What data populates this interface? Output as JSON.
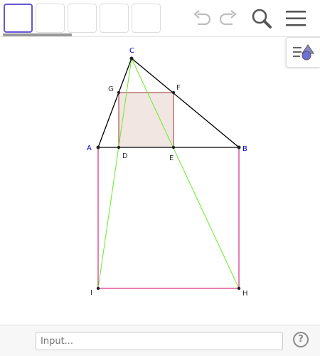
{
  "toolbar": {
    "tools": [
      {
        "name": "tool-slot-1",
        "active": true
      },
      {
        "name": "tool-slot-2",
        "active": false
      },
      {
        "name": "tool-slot-3",
        "active": false
      },
      {
        "name": "tool-slot-4",
        "active": false
      },
      {
        "name": "tool-slot-5",
        "active": false
      }
    ],
    "icons": [
      "undo-icon",
      "redo-icon",
      "search-icon",
      "menu-icon"
    ]
  },
  "algebra_toggle": {
    "icon": "algebra-view-icon"
  },
  "construction": {
    "points": [
      {
        "label": "A",
        "color": "#0000cc"
      },
      {
        "label": "B",
        "color": "#0000cc"
      },
      {
        "label": "C",
        "color": "#0000cc"
      },
      {
        "label": "D",
        "color": "#333333"
      },
      {
        "label": "E",
        "color": "#333333"
      },
      {
        "label": "F",
        "color": "#333333"
      },
      {
        "label": "G",
        "color": "#333333"
      },
      {
        "label": "H",
        "color": "#333333"
      },
      {
        "label": "I",
        "color": "#333333"
      }
    ],
    "colors": {
      "triangle": "#000000",
      "square_stroke": "#993333",
      "square_fill": "#f2e6e3",
      "outer_square": "#cc0066",
      "diagonals": "#66ee22",
      "accent": "#6557d2"
    }
  },
  "input_bar": {
    "placeholder": "Input..."
  },
  "help": {
    "label": "?"
  }
}
